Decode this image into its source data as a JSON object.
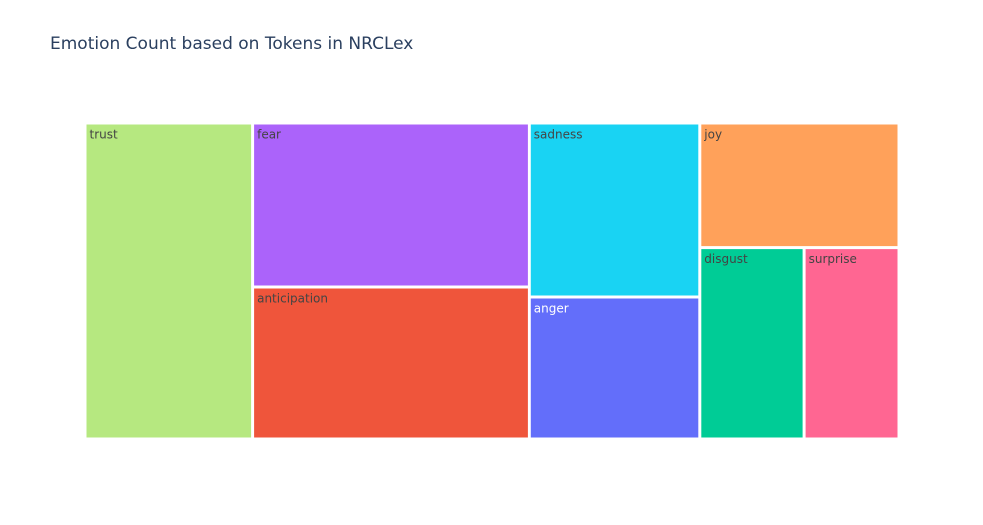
{
  "chart_data": {
    "type": "treemap",
    "title": "Emotion Count based on Tokens in NRCLex",
    "items": [
      {
        "label": "trust",
        "value": 1750,
        "color": "#b6e880",
        "label_color": "#444444"
      },
      {
        "label": "fear",
        "value": 1500,
        "color": "#ab63fa",
        "label_color": "#444444"
      },
      {
        "label": "anticipation",
        "value": 1390,
        "color": "#ef553b",
        "label_color": "#444444"
      },
      {
        "label": "sadness",
        "value": 980,
        "color": "#19d3f3",
        "label_color": "#444444"
      },
      {
        "label": "anger",
        "value": 800,
        "color": "#636efa",
        "label_color": "#ffffff"
      },
      {
        "label": "joy",
        "value": 820,
        "color": "#ffa15a",
        "label_color": "#444444"
      },
      {
        "label": "disgust",
        "value": 660,
        "color": "#00cc96",
        "label_color": "#444444"
      },
      {
        "label": "surprise",
        "value": 600,
        "color": "#ff6692",
        "label_color": "#444444"
      }
    ]
  }
}
